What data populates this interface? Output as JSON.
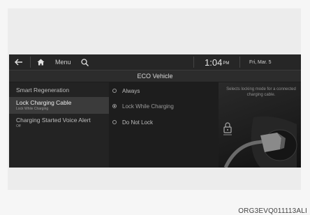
{
  "topbar": {
    "back_icon": "back-arrow-icon",
    "home_icon": "home-icon",
    "menu_label": "Menu",
    "search_icon": "search-icon",
    "time": "1:04",
    "time_suffix": "PM",
    "date": "Fri, Mar. 5"
  },
  "header": {
    "title": "ECO Vehicle"
  },
  "sidebar": {
    "items": [
      {
        "label": "Smart Regeneration",
        "sub": ""
      },
      {
        "label": "Lock Charging Cable",
        "sub": "Lock While Charging",
        "selected": true
      },
      {
        "label": "Charging Started Voice Alert",
        "sub": "Off"
      }
    ]
  },
  "options": {
    "items": [
      {
        "label": "Always",
        "selected": false
      },
      {
        "label": "Lock While Charging",
        "selected": true
      },
      {
        "label": "Do Not Lock",
        "selected": false
      }
    ]
  },
  "info": {
    "description": "Selects locking mode for a connected charging cable.",
    "illustration_icon": "charging-plug-lock-icon"
  },
  "caption": {
    "code": "ORG3EVQ011113ALI"
  },
  "colors": {
    "screen_bg": "#1d1d1d",
    "highlight": "#3b3b3b",
    "text": "#cfcfcf"
  }
}
